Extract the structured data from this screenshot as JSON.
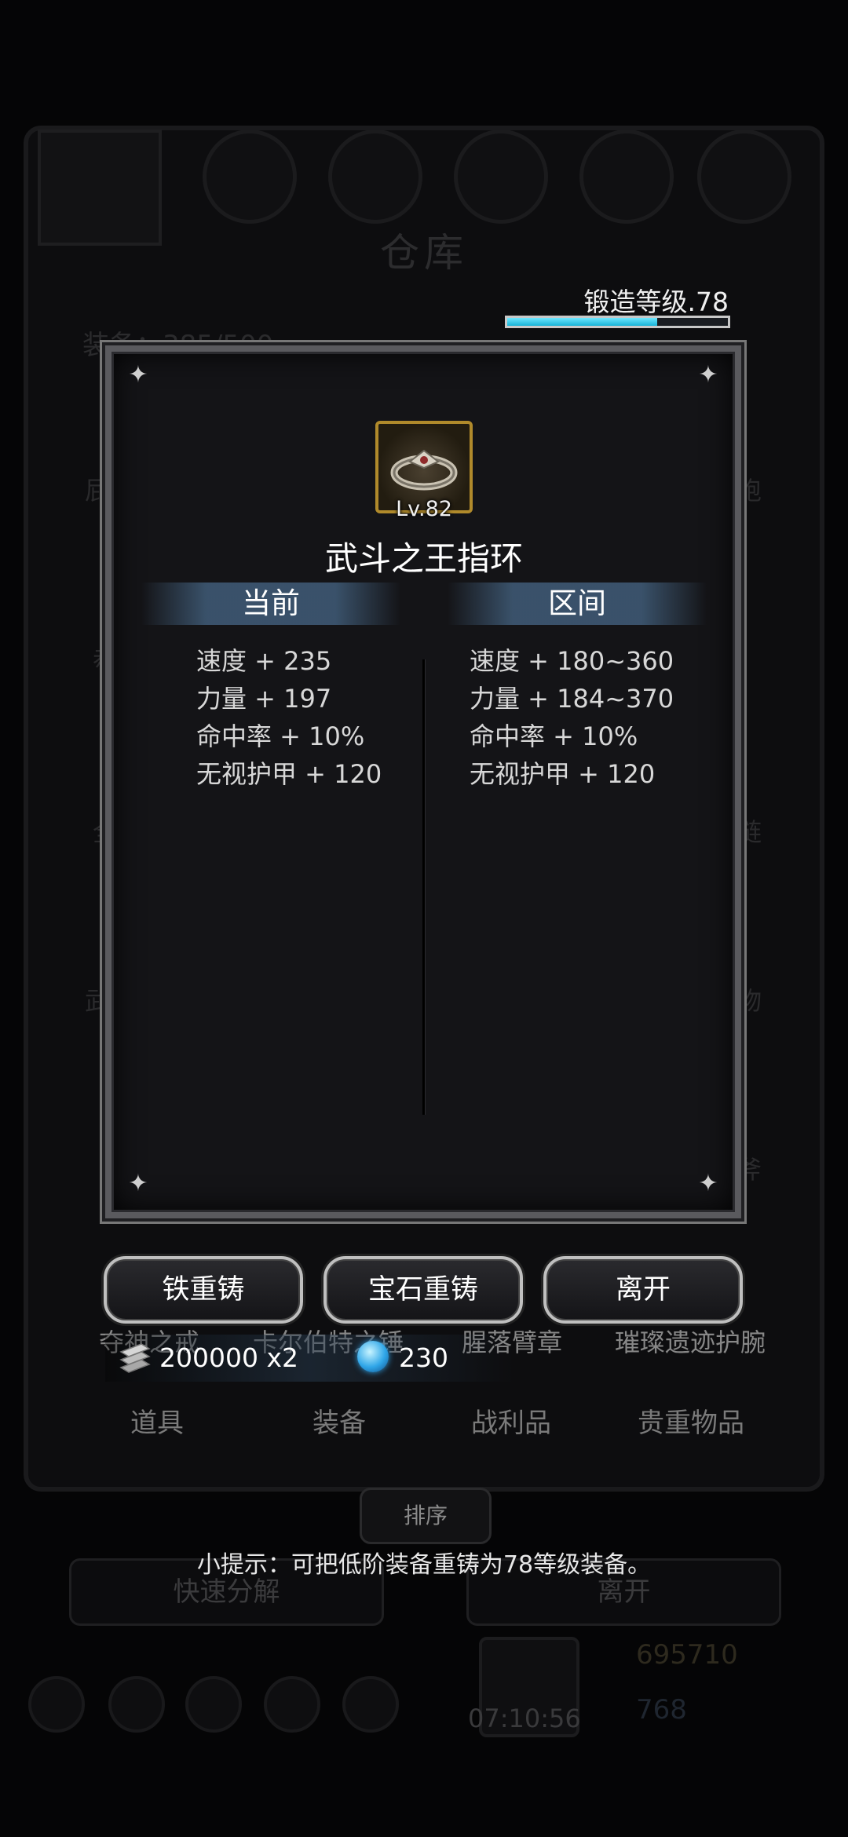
{
  "background": {
    "title": "仓库",
    "equip_count": "装备：385/500",
    "side_left": [
      "屁",
      "恭",
      "全",
      "武"
    ],
    "side_right": [
      "袍",
      "链",
      "物",
      "斧"
    ],
    "item_names": [
      "夺神之戒",
      "卡尔伯特之锤",
      "腥落臂章",
      "璀璨遗迹护腕"
    ],
    "tabs": [
      "道具",
      "装备",
      "战利品",
      "贵重物品"
    ],
    "sort_label": "排序",
    "quick_decompose": "快速分解",
    "leave": "离开",
    "timer": "07:10:56",
    "gold": "695710",
    "gems": "768"
  },
  "forge": {
    "label": "锻造等级.78",
    "progress": 0.68,
    "bar_color": "#2fc4e6"
  },
  "item": {
    "level": "Lv.82",
    "name": "武斗之王指环",
    "icon": "ring-icon",
    "frame_color": "#b08a2b"
  },
  "columns": {
    "current_header": "当前",
    "range_header": "区间"
  },
  "current_stats": [
    "速度 + 235",
    "力量 + 197",
    "命中率 + 10%",
    "无视护甲 + 120"
  ],
  "range_stats": [
    "速度 + 180~360",
    "力量 + 184~370",
    "命中率 + 10%",
    "无视护甲 + 120"
  ],
  "buttons": {
    "iron_reforge": "铁重铸",
    "gem_reforge": "宝石重铸",
    "leave": "离开"
  },
  "cost": {
    "iron": "200000 x2",
    "gem": "230",
    "iron_icon": "iron-ingot-icon",
    "gem_icon": "blue-gem-icon"
  },
  "tip": "小提示：可把低阶装备重铸为78等级装备。"
}
